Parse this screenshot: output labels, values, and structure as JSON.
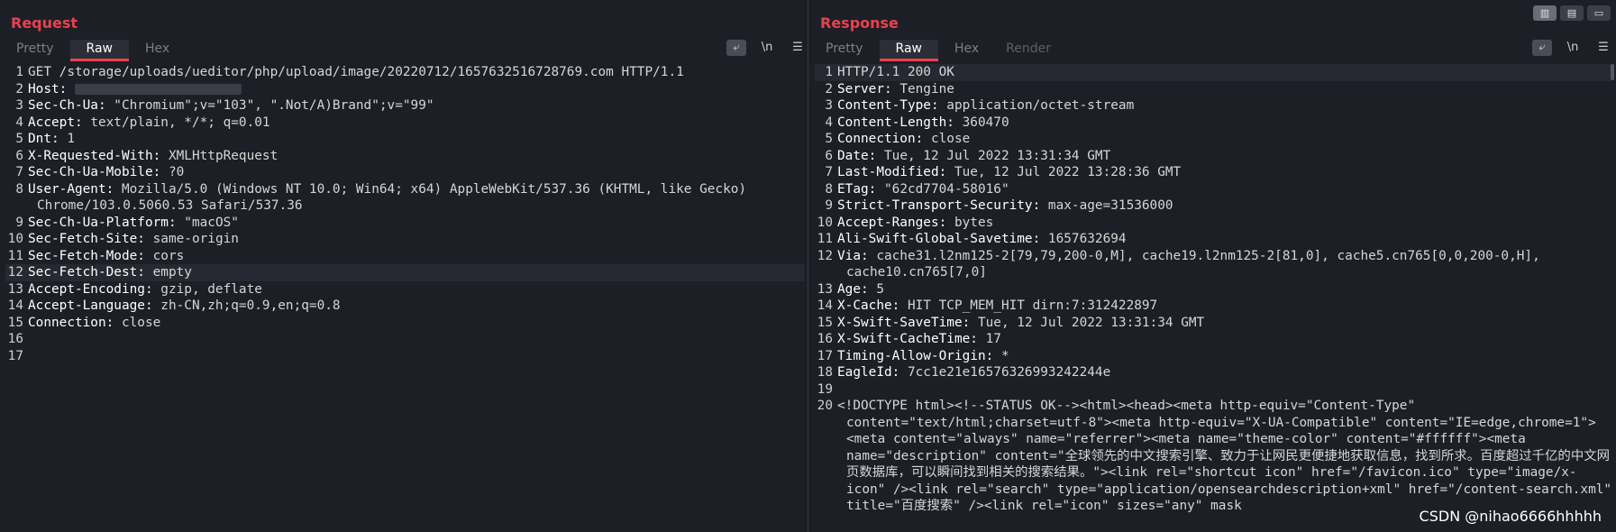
{
  "request": {
    "title": "Request",
    "tabs": [
      "Pretty",
      "Raw",
      "Hex"
    ],
    "active_tab": "Raw",
    "tools": {
      "wrap": "⤶",
      "newline": "\\n",
      "menu": "☰"
    },
    "lines": [
      {
        "n": "1",
        "key": "",
        "val": "GET /storage/uploads/ueditor/php/upload/image/20220712/1657632516728769.com HTTP/1.1"
      },
      {
        "n": "2",
        "key": "Host:",
        "val": "",
        "blurred": true
      },
      {
        "n": "3",
        "key": "Sec-Ch-Ua:",
        "val": " \"Chromium\";v=\"103\", \".Not/A)Brand\";v=\"99\""
      },
      {
        "n": "4",
        "key": "Accept:",
        "val": " text/plain, */*; q=0.01"
      },
      {
        "n": "5",
        "key": "Dnt:",
        "val": " 1"
      },
      {
        "n": "6",
        "key": "X-Requested-With:",
        "val": " XMLHttpRequest"
      },
      {
        "n": "7",
        "key": "Sec-Ch-Ua-Mobile:",
        "val": " ?0"
      },
      {
        "n": "8",
        "key": "User-Agent:",
        "val": " Mozilla/5.0 (Windows NT 10.0; Win64; x64) AppleWebKit/537.36 (KHTML, like Gecko) Chrome/103.0.5060.53 Safari/537.36"
      },
      {
        "n": "9",
        "key": "Sec-Ch-Ua-Platform:",
        "val": " \"macOS\""
      },
      {
        "n": "10",
        "key": "Sec-Fetch-Site:",
        "val": " same-origin"
      },
      {
        "n": "11",
        "key": "Sec-Fetch-Mode:",
        "val": " cors"
      },
      {
        "n": "12",
        "key": "Sec-Fetch-Dest:",
        "val": " empty",
        "highlight": true
      },
      {
        "n": "13",
        "key": "Accept-Encoding:",
        "val": " gzip, deflate"
      },
      {
        "n": "14",
        "key": "Accept-Language:",
        "val": " zh-CN,zh;q=0.9,en;q=0.8"
      },
      {
        "n": "15",
        "key": "Connection:",
        "val": " close"
      },
      {
        "n": "16",
        "key": "",
        "val": ""
      },
      {
        "n": "17",
        "key": "",
        "val": ""
      }
    ]
  },
  "response": {
    "title": "Response",
    "tabs": [
      "Pretty",
      "Raw",
      "Hex",
      "Render"
    ],
    "active_tab": "Raw",
    "tools": {
      "wrap": "⤶",
      "newline": "\\n",
      "menu": "☰"
    },
    "lines": [
      {
        "n": "1",
        "key": "",
        "val": "HTTP/1.1 200 OK",
        "highlight": true
      },
      {
        "n": "2",
        "key": "Server:",
        "val": " Tengine"
      },
      {
        "n": "3",
        "key": "Content-Type:",
        "val": " application/octet-stream"
      },
      {
        "n": "4",
        "key": "Content-Length:",
        "val": " 360470"
      },
      {
        "n": "5",
        "key": "Connection:",
        "val": " close"
      },
      {
        "n": "6",
        "key": "Date:",
        "val": " Tue, 12 Jul 2022 13:31:34 GMT"
      },
      {
        "n": "7",
        "key": "Last-Modified:",
        "val": " Tue, 12 Jul 2022 13:28:36 GMT"
      },
      {
        "n": "8",
        "key": "ETag:",
        "val": " \"62cd7704-58016\""
      },
      {
        "n": "9",
        "key": "Strict-Transport-Security:",
        "val": " max-age=31536000"
      },
      {
        "n": "10",
        "key": "Accept-Ranges:",
        "val": " bytes"
      },
      {
        "n": "11",
        "key": "Ali-Swift-Global-Savetime:",
        "val": " 1657632694"
      },
      {
        "n": "12",
        "key": "Via:",
        "val": " cache31.l2nm125-2[79,79,200-0,M], cache19.l2nm125-2[81,0], cache5.cn765[0,0,200-0,H], cache10.cn765[7,0]"
      },
      {
        "n": "13",
        "key": "Age:",
        "val": " 5"
      },
      {
        "n": "14",
        "key": "X-Cache:",
        "val": " HIT TCP_MEM_HIT dirn:7:312422897"
      },
      {
        "n": "15",
        "key": "X-Swift-SaveTime:",
        "val": " Tue, 12 Jul 2022 13:31:34 GMT"
      },
      {
        "n": "16",
        "key": "X-Swift-CacheTime:",
        "val": " 17"
      },
      {
        "n": "17",
        "key": "Timing-Allow-Origin:",
        "val": " *"
      },
      {
        "n": "18",
        "key": "EagleId:",
        "val": " 7cc1e21e16576326993242244e"
      },
      {
        "n": "19",
        "key": "",
        "val": ""
      },
      {
        "n": "20",
        "key": "",
        "val": "<!DOCTYPE html><!--STATUS OK--><html><head><meta http-equiv=\"Content-Type\" content=\"text/html;charset=utf-8\"><meta http-equiv=\"X-UA-Compatible\" content=\"IE=edge,chrome=1\"><meta content=\"always\" name=\"referrer\"><meta name=\"theme-color\" content=\"#ffffff\"><meta name=\"description\" content=\"全球领先的中文搜索引擎、致力于让网民更便捷地获取信息，找到所求。百度超过千亿的中文网页数据库，可以瞬间找到相关的搜索结果。\"><link rel=\"shortcut icon\" href=\"/favicon.ico\" type=\"image/x-icon\" /><link rel=\"search\" type=\"application/opensearchdescription+xml\" href=\"/content-search.xml\" title=\"百度搜索\" /><link rel=\"icon\" sizes=\"any\" mask"
      }
    ]
  },
  "layout_buttons": [
    "▥",
    "▤",
    "▭"
  ],
  "watermark": "CSDN @nihao6666hhhhh"
}
